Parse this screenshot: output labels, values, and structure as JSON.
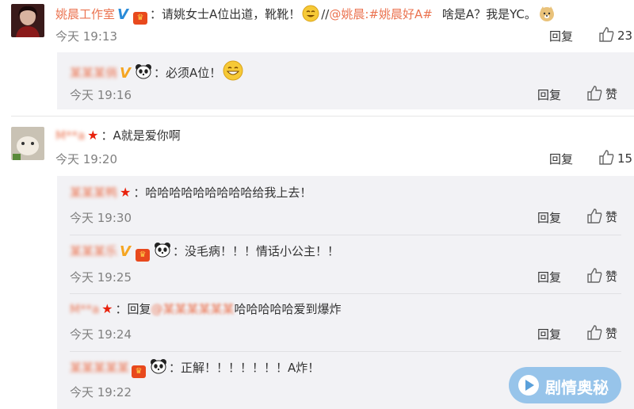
{
  "c1": {
    "name": "姚晨工作室",
    "colon": "：",
    "text1": "请姚女士A位出道，靴靴！",
    "sep": "//",
    "mention": "@姚晨",
    "topic_colon": ":",
    "topic": "#姚晨好A#",
    "text2": "啥是A？我是YC。",
    "time": "今天 19:13",
    "reply_label": "回复",
    "likes": "23"
  },
  "c1r1": {
    "name": "某某某俏",
    "colon": "：",
    "text": "必须A位！",
    "time": "今天 19:16",
    "reply_label": "回复",
    "like_label": "赞"
  },
  "c2": {
    "name": "M**a",
    "colon": "：",
    "text": "A就是爱你啊",
    "time": "今天 19:20",
    "reply_label": "回复",
    "likes": "15"
  },
  "c2r1": {
    "name": "某某某鸭",
    "colon": "：",
    "text": "哈哈哈哈哈哈哈哈哈给我上去！",
    "time": "今天 19:30",
    "reply_label": "回复",
    "like_label": "赞"
  },
  "c2r2": {
    "name": "某某某乐",
    "colon": "：",
    "text": "没毛病！！！情话小公主！！",
    "time": "今天 19:25",
    "reply_label": "回复",
    "like_label": "赞"
  },
  "c2r3": {
    "name": "M**a",
    "colon": "：",
    "prefix": "回复",
    "mention": "@某某某某某某",
    "text": "哈哈哈哈哈爱到爆炸",
    "time": "今天 19:24",
    "reply_label": "回复",
    "like_label": "赞"
  },
  "c2r4": {
    "name": "某某某某某",
    "colon": "：",
    "text": "正解！！！！！！！A炸！",
    "time": "今天 19:22"
  },
  "watermark": {
    "text": "剧情奥秘"
  },
  "colors": {
    "name": "#eb7350",
    "meta": "#808080",
    "reply_bg": "#f2f2f5"
  }
}
